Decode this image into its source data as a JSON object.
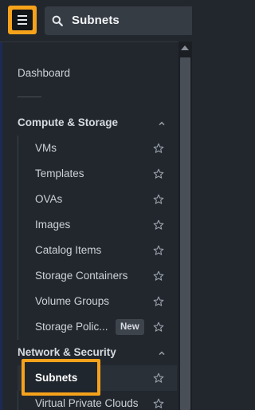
{
  "search": {
    "value": "Subnets"
  },
  "nav": {
    "dashboard": "Dashboard",
    "sections": [
      {
        "title": "Compute & Storage",
        "items": [
          {
            "label": "VMs"
          },
          {
            "label": "Templates"
          },
          {
            "label": "OVAs"
          },
          {
            "label": "Images"
          },
          {
            "label": "Catalog Items"
          },
          {
            "label": "Storage Containers"
          },
          {
            "label": "Volume Groups"
          },
          {
            "label": "Storage Polic...",
            "badge": "New"
          }
        ]
      },
      {
        "title": "Network & Security",
        "items": [
          {
            "label": "Subnets",
            "active": true
          },
          {
            "label": "Virtual Private Clouds"
          }
        ]
      }
    ]
  },
  "colors": {
    "accent": "#f7a21b",
    "background": "#22272e",
    "text": "#cdd2d8"
  },
  "icons": {
    "menu": "hamburger-menu-icon",
    "search": "search-icon",
    "star": "star-outline-icon",
    "chevron": "chevron-up-icon"
  }
}
